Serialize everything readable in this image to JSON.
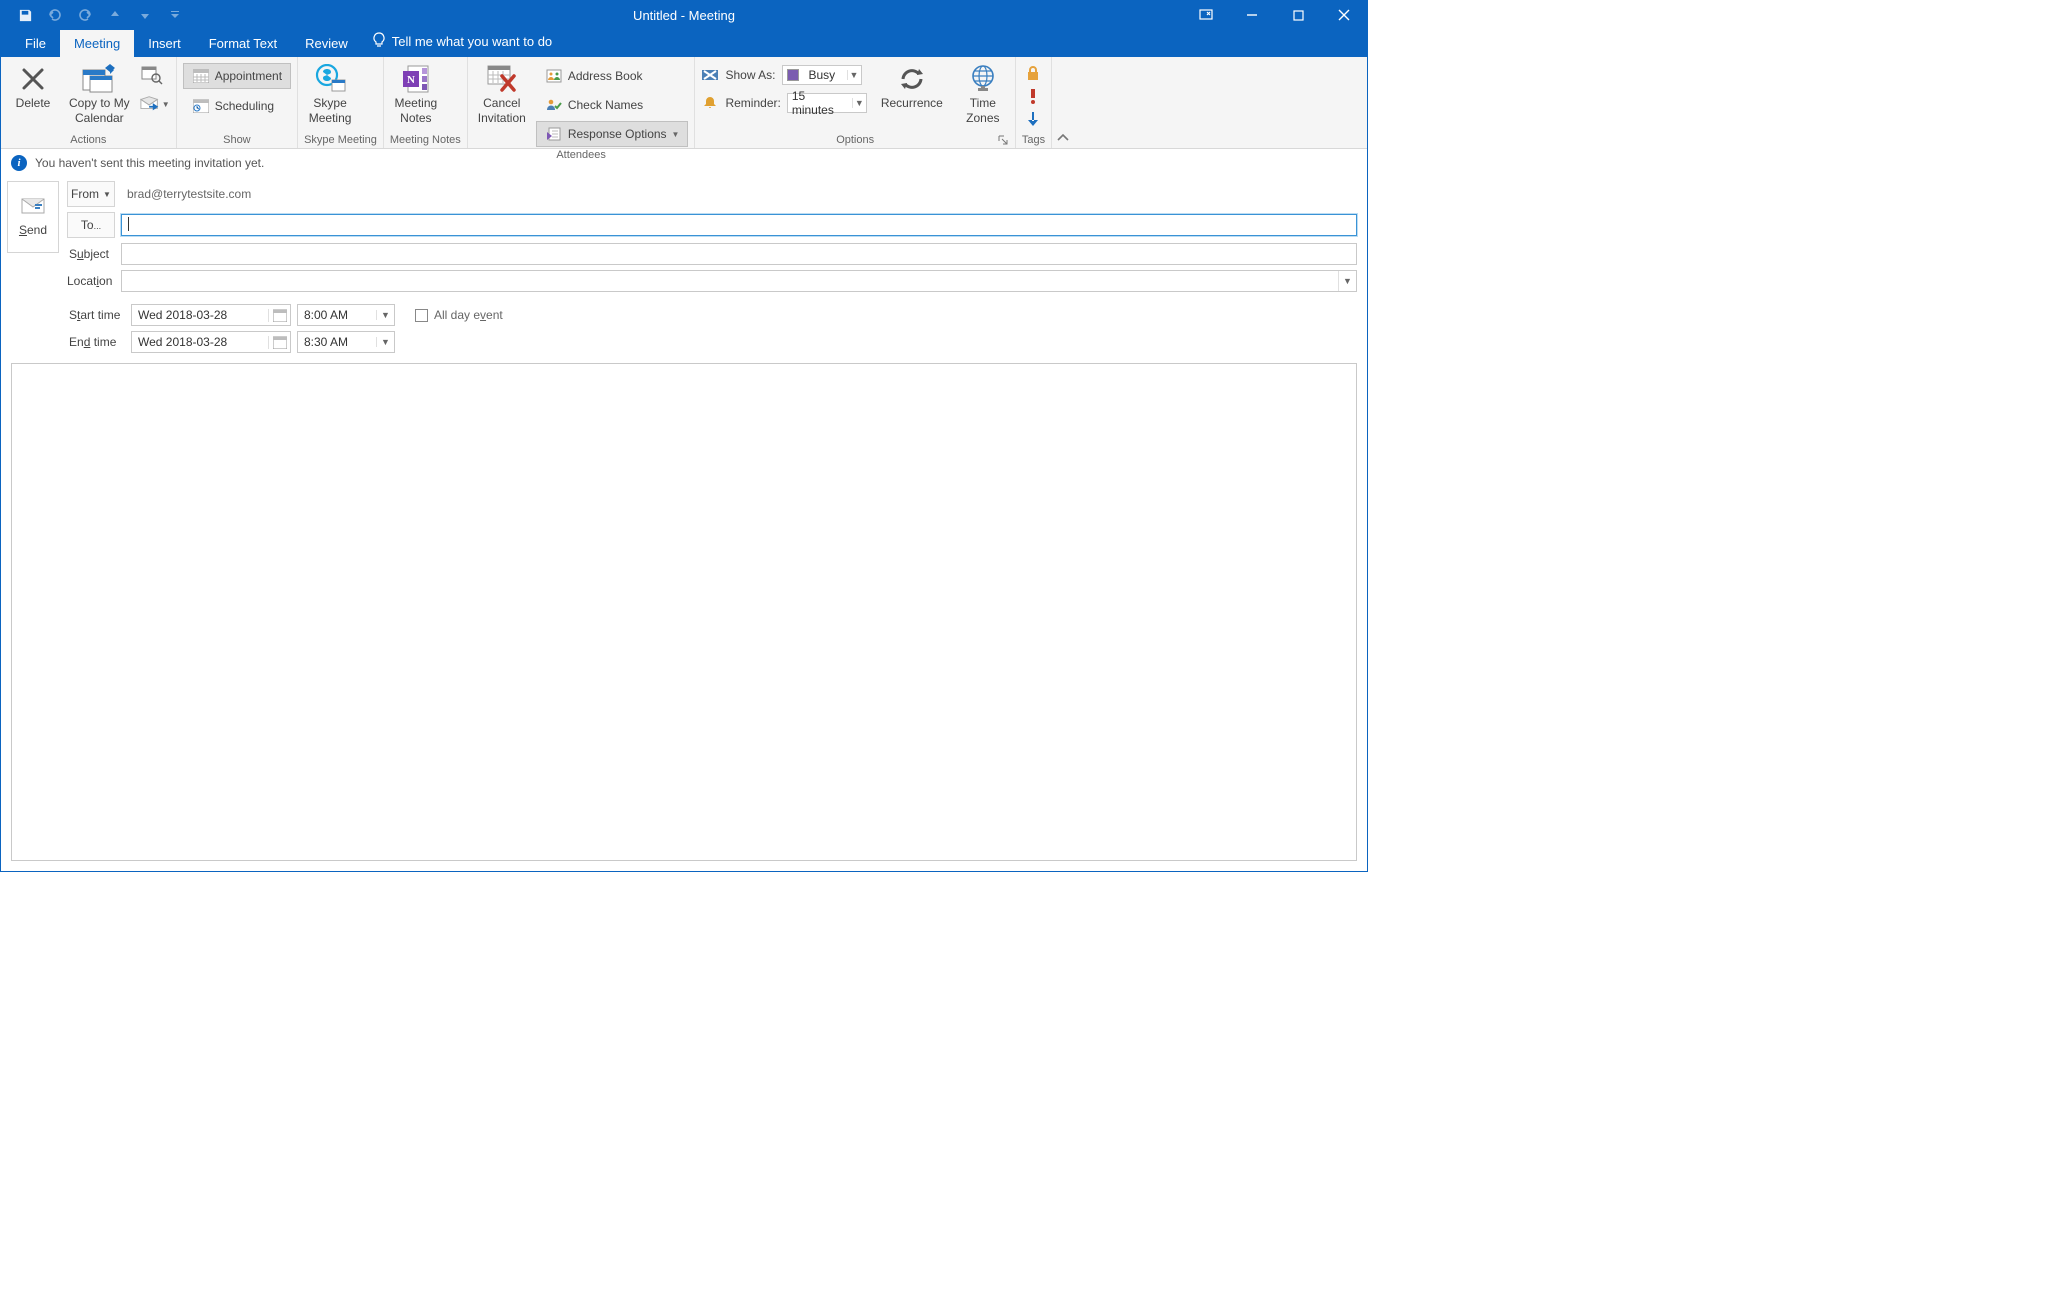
{
  "titlebar": {
    "title": "Untitled  -  Meeting"
  },
  "tabs": {
    "file": "File",
    "meeting": "Meeting",
    "insert": "Insert",
    "format_text": "Format Text",
    "review": "Review",
    "tellme": "Tell me what you want to do"
  },
  "ribbon": {
    "actions": {
      "label": "Actions",
      "delete": "Delete",
      "copy_to_my_calendar_l1": "Copy to My",
      "copy_to_my_calendar_l2": "Calendar"
    },
    "show": {
      "label": "Show",
      "appointment": "Appointment",
      "scheduling": "Scheduling"
    },
    "skype": {
      "label": "Skype Meeting",
      "skype_l1": "Skype",
      "skype_l2": "Meeting"
    },
    "notes": {
      "label": "Meeting Notes",
      "notes_l1": "Meeting",
      "notes_l2": "Notes"
    },
    "attendees": {
      "label": "Attendees",
      "cancel_l1": "Cancel",
      "cancel_l2": "Invitation",
      "address_book": "Address Book",
      "check_names": "Check Names",
      "response_options": "Response Options"
    },
    "options": {
      "label": "Options",
      "show_as": "Show As:",
      "show_as_value": "Busy",
      "reminder": "Reminder:",
      "reminder_value": "15 minutes",
      "recurrence": "Recurrence",
      "time_zones_l1": "Time",
      "time_zones_l2": "Zones"
    },
    "tags": {
      "label": "Tags"
    }
  },
  "info": {
    "text": "You haven't sent this meeting invitation yet."
  },
  "form": {
    "send": "Send",
    "from_btn": "From",
    "from_value": "brad@terrytestsite.com",
    "to_btn": "To...",
    "subject_label": "Subject",
    "location_label": "Location",
    "start_label": "Start time",
    "end_label": "End time",
    "start_date": "Wed 2018-03-28",
    "start_time": "8:00 AM",
    "end_date": "Wed 2018-03-28",
    "end_time": "8:30 AM",
    "all_day": "All day event"
  }
}
